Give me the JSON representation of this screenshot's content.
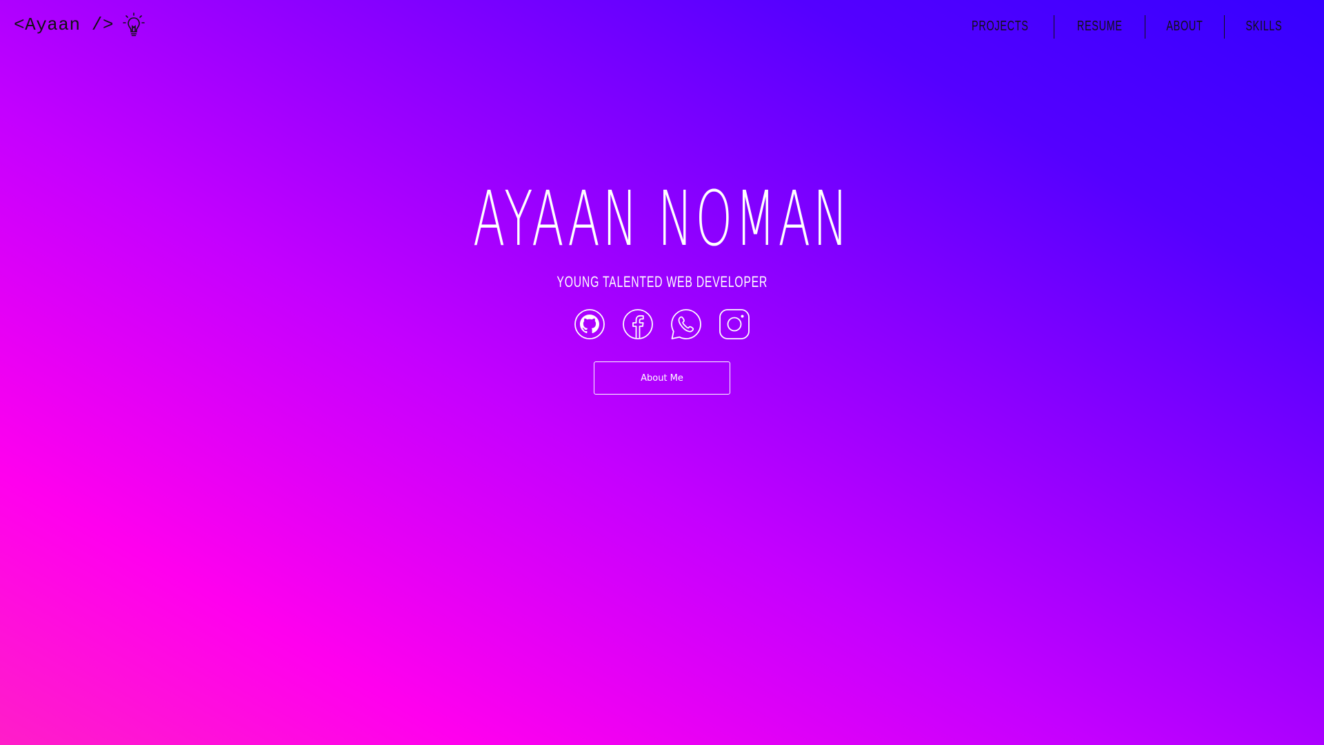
{
  "header": {
    "logo_text": "<Ayaan />",
    "logo_icon": "lightbulb-icon"
  },
  "nav": {
    "items": [
      {
        "label": "PROJECTS"
      },
      {
        "label": "RESUME"
      },
      {
        "label": "ABOUT"
      },
      {
        "label": "SKILLS"
      }
    ]
  },
  "hero": {
    "title": "AYAAN NOMAN",
    "subtitle": "YOUNG TALENTED WEB DEVELOPER",
    "socials": [
      "github-icon",
      "facebook-icon",
      "whatsapp-icon",
      "instagram-icon"
    ],
    "button_label": "About Me"
  },
  "colors": {
    "gradient_start": "#ff1ec8",
    "gradient_mid": "#c400ff",
    "gradient_end": "#3600ff",
    "text_light": "#ffffff",
    "text_dark": "#111111"
  }
}
